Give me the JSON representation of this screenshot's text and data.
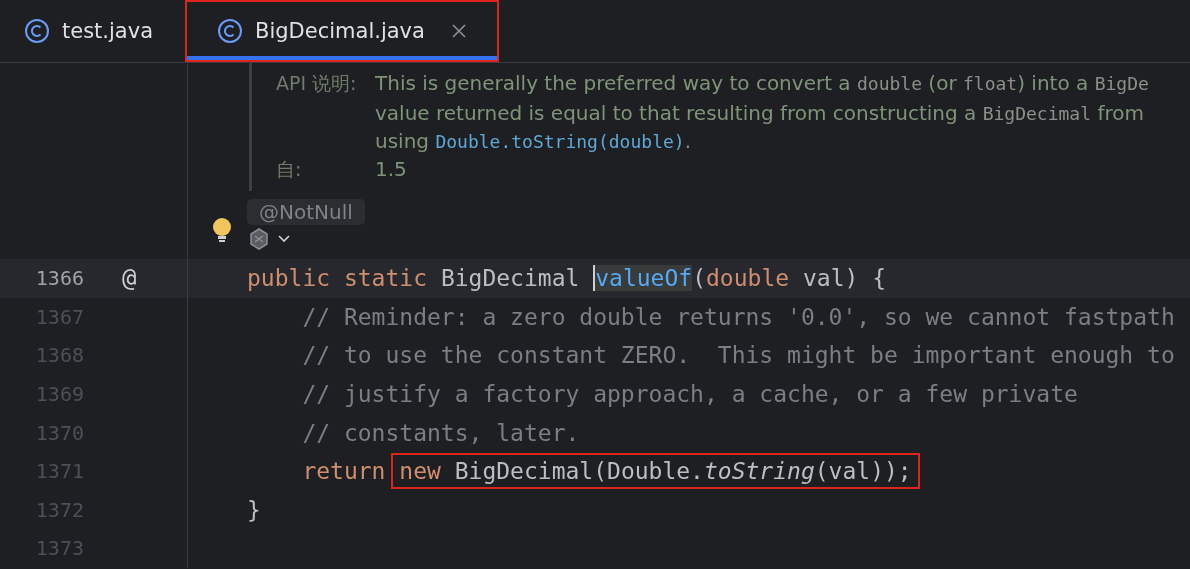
{
  "tabs": [
    {
      "label": "test.java",
      "selected": false,
      "closable": false,
      "highlighted": false
    },
    {
      "label": "BigDecimal.java",
      "selected": true,
      "closable": true,
      "highlighted": true
    }
  ],
  "doc": {
    "entries": [
      {
        "label": "API 说明:",
        "lines": [
          [
            {
              "text": "This is generally the preferred way to convert a ",
              "kind": "text"
            },
            {
              "text": "double",
              "kind": "code"
            },
            {
              "text": " (or ",
              "kind": "text"
            },
            {
              "text": "float",
              "kind": "code"
            },
            {
              "text": ") into a ",
              "kind": "text"
            },
            {
              "text": "BigDe",
              "kind": "code"
            }
          ],
          [
            {
              "text": "value returned is equal to that resulting from constructing a ",
              "kind": "text"
            },
            {
              "text": "BigDecimal",
              "kind": "code"
            },
            {
              "text": " from",
              "kind": "text"
            }
          ],
          [
            {
              "text": "using ",
              "kind": "text"
            },
            {
              "text": "Double.toString(double)",
              "kind": "link"
            },
            {
              "text": ".",
              "kind": "text"
            }
          ]
        ]
      },
      {
        "label": "自:",
        "lines": [
          [
            {
              "text": "1.5",
              "kind": "text"
            }
          ]
        ]
      }
    ]
  },
  "inlay": {
    "annotation": "@NotNull"
  },
  "lines": [
    {
      "number": "1366",
      "current": true,
      "marker": "@",
      "tokens": [
        {
          "text": "public static ",
          "kind": "keyword"
        },
        {
          "text": "BigDecimal ",
          "kind": "plain"
        },
        {
          "text": "valueOf",
          "kind": "method",
          "caret": true
        },
        {
          "text": "(",
          "kind": "plain"
        },
        {
          "text": "double ",
          "kind": "keyword"
        },
        {
          "text": "val) {",
          "kind": "plain"
        }
      ]
    },
    {
      "number": "1367",
      "current": false,
      "tokens": [
        {
          "text": "    // Reminder: a zero double returns '0.0', so we cannot fastpath",
          "kind": "comment"
        }
      ]
    },
    {
      "number": "1368",
      "current": false,
      "tokens": [
        {
          "text": "    // to use the constant ZERO.  This might be important enough to",
          "kind": "comment"
        }
      ]
    },
    {
      "number": "1369",
      "current": false,
      "tokens": [
        {
          "text": "    // justify a factory approach, a cache, or a few private",
          "kind": "comment"
        }
      ]
    },
    {
      "number": "1370",
      "current": false,
      "tokens": [
        {
          "text": "    // constants, later.",
          "kind": "comment"
        }
      ]
    },
    {
      "number": "1371",
      "current": false,
      "tokens": [
        {
          "text": "    return ",
          "kind": "keyword"
        },
        {
          "kind": "group",
          "boxed": true,
          "tokens": [
            {
              "text": "new ",
              "kind": "keyword"
            },
            {
              "text": "BigDecimal(Double.",
              "kind": "plain"
            },
            {
              "text": "toString",
              "kind": "italic"
            },
            {
              "text": "(val));",
              "kind": "plain"
            }
          ]
        }
      ]
    },
    {
      "number": "1372",
      "current": false,
      "tokens": [
        {
          "text": "}",
          "kind": "plain"
        }
      ]
    },
    {
      "number": "1373",
      "current": false
    }
  ]
}
